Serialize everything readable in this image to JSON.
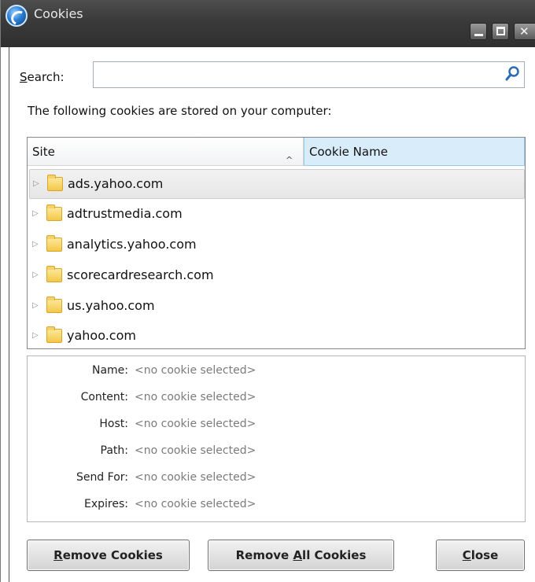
{
  "window": {
    "title": "Cookies"
  },
  "search": {
    "label_accel": "S",
    "label_rest": "earch:",
    "value": "",
    "placeholder": ""
  },
  "description": "The following cookies are stored on your computer:",
  "tree": {
    "columns": {
      "site": "Site",
      "cookie_name": "Cookie Name"
    },
    "sort_indicator": "^",
    "rows": [
      {
        "label": "ads.yahoo.com"
      },
      {
        "label": "adtrustmedia.com"
      },
      {
        "label": "analytics.yahoo.com"
      },
      {
        "label": "scorecardresearch.com"
      },
      {
        "label": "us.yahoo.com"
      },
      {
        "label": "yahoo.com"
      }
    ]
  },
  "details": {
    "placeholder": "<no cookie selected>",
    "fields": [
      {
        "label": "Name:",
        "value": "<no cookie selected>"
      },
      {
        "label": "Content:",
        "value": "<no cookie selected>"
      },
      {
        "label": "Host:",
        "value": "<no cookie selected>"
      },
      {
        "label": "Path:",
        "value": "<no cookie selected>"
      },
      {
        "label": "Send For:",
        "value": "<no cookie selected>"
      },
      {
        "label": "Expires:",
        "value": "<no cookie selected>"
      }
    ]
  },
  "buttons": {
    "remove": {
      "accel": "R",
      "rest": "emove Cookies"
    },
    "remove_all": {
      "pre": "Remove ",
      "accel": "A",
      "rest": "ll Cookies"
    },
    "close": {
      "accel": "C",
      "rest": "lose"
    }
  },
  "colors": {
    "titlebar": "#3a3a3a",
    "column_highlight": "#d9ecf9",
    "detail_value": "#7b7b7b"
  },
  "icons": {
    "window": "firefox-icon",
    "search": "search-icon",
    "row": "folder-icon",
    "expander": "triangle-right-icon"
  }
}
